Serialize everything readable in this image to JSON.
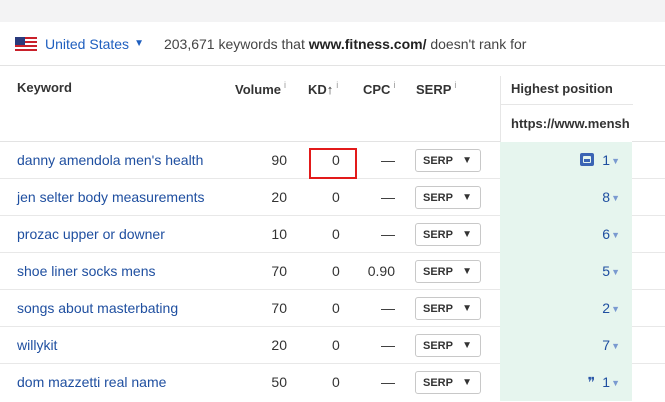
{
  "filter": {
    "country": "United States",
    "summary_count": "203,671",
    "summary_pre": "keywords that",
    "summary_domain": "www.fitness.com/",
    "summary_post": "doesn't rank for"
  },
  "columns": {
    "keyword": "Keyword",
    "volume": "Volume",
    "kd": "KD",
    "kd_sort": "↑",
    "cpc": "CPC",
    "serp": "SERP",
    "info": "i",
    "highest_position": "Highest position",
    "highest_position_url": "https://www.menshe"
  },
  "rows": [
    {
      "keyword": "danny amendola men's health",
      "volume": "90",
      "kd": "0",
      "cpc": "—",
      "serp": "SERP",
      "position": "1",
      "feature": "image"
    },
    {
      "keyword": "jen selter body measurements",
      "volume": "20",
      "kd": "0",
      "cpc": "—",
      "serp": "SERP",
      "position": "8",
      "feature": ""
    },
    {
      "keyword": "prozac upper or downer",
      "volume": "10",
      "kd": "0",
      "cpc": "—",
      "serp": "SERP",
      "position": "6",
      "feature": ""
    },
    {
      "keyword": "shoe liner socks mens",
      "volume": "70",
      "kd": "0",
      "cpc": "0.90",
      "serp": "SERP",
      "position": "5",
      "feature": ""
    },
    {
      "keyword": "songs about masterbating",
      "volume": "70",
      "kd": "0",
      "cpc": "—",
      "serp": "SERP",
      "position": "2",
      "feature": ""
    },
    {
      "keyword": "willykit",
      "volume": "20",
      "kd": "0",
      "cpc": "—",
      "serp": "SERP",
      "position": "7",
      "feature": ""
    },
    {
      "keyword": "dom mazzetti real name",
      "volume": "50",
      "kd": "0",
      "cpc": "—",
      "serp": "SERP",
      "position": "1",
      "feature": "quote"
    }
  ],
  "icons": {
    "flag": "us-flag-icon",
    "dropdown": "chevron-down-icon",
    "image_feature": "image-icon",
    "quote_feature": "quote-icon"
  },
  "colors": {
    "link": "#1f4fa0",
    "position_cell_bg": "#e6f5ee",
    "highlight": "#e21a1a"
  }
}
